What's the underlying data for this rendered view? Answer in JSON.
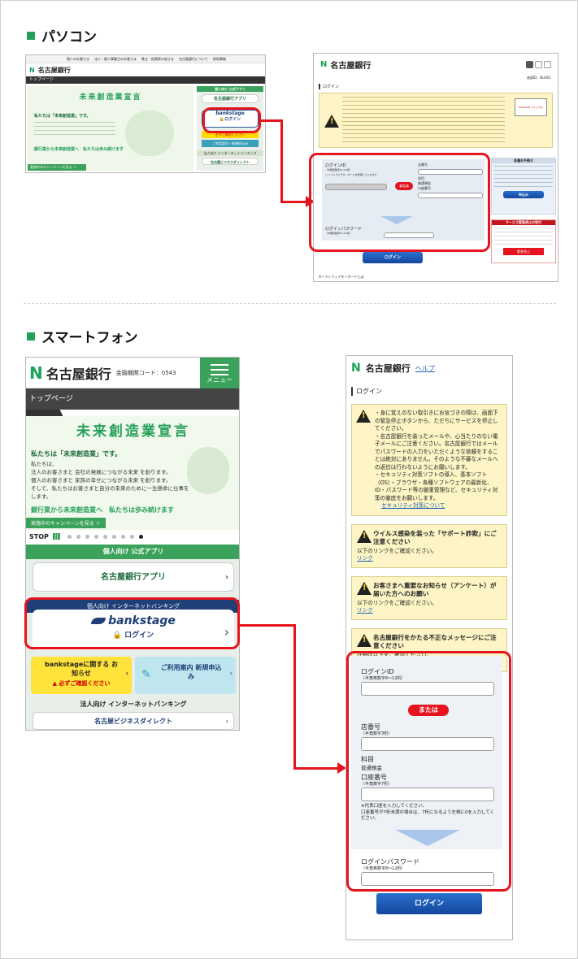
{
  "sections": {
    "pc_title": "パソコン",
    "sp_title": "スマートフォン"
  },
  "brand": {
    "bank_name": "名古屋銀行",
    "branch_code": "金融機関コード：0543",
    "menu": "メニュー",
    "accent": "#3aa25a",
    "red": "#e5141e"
  },
  "pc_top": {
    "nav_items": [
      "個人のお客さま",
      "法人・個人事業主のお客さま",
      "株主・投資家の皆さま",
      "名古屋銀行について",
      "採用情報"
    ],
    "breadcrumb": "トップページ",
    "hero_title": "未来創造業宣言",
    "hero_lead": "私たちは「未来創造業」です。",
    "hero_slogan": "銀行業から未来創造業へ　私たちは歩み続けます",
    "campaign": "実施中のキャンペーンを見る ＞",
    "app_head": "個人向け 公式アプリ",
    "app_btn": "名古屋銀行アプリ",
    "bankstage": "bankstage",
    "login": "ログイン",
    "notice": "必ずご確認ください",
    "guide": "ご利用案内・新規申込み",
    "corp_head": "法人向け インターネットバンキング",
    "corp_btn": "名古屋ビジネスダイレクト"
  },
  "pc_login": {
    "page_label": "ログイン",
    "screen_id": "画面ID：BLI001",
    "or_label": "または",
    "login_id": "ログインID",
    "login_id_hint": "（半角英数字6〜12桁）",
    "software_kb": "ソフトウェアキーボードを使用して入力する",
    "store_no": "店番号",
    "store_hint": "（半角数字3桁）",
    "subject": "科目",
    "subject_val": "普通預金",
    "account": "口座番号",
    "account_hint": "（半角数字7桁）",
    "password": "ログインパスワード",
    "password_hint": "（半角英数字8〜12桁）",
    "login_btn": "ログイン",
    "footer": "※ソフトウェアキーボードとは",
    "side_title": "各種お手続き",
    "side_btn": "申込み",
    "stop_title": "サービス緊急停止の受付",
    "stop_btn": "緊急停止",
    "phish_badge": "PhishWall プレミアム"
  },
  "sp_top": {
    "breadcrumb": "トップページ",
    "hero_title": "未来創造業宣言",
    "hero_lead": "私たちは「未来創造業」です。",
    "hero_body": [
      "私たちは、",
      "法人のお客さまと 会社の発展につながる未来 を創ります。",
      "個人のお客さまと 家族の幸せにつながる未来 を創ります。",
      "そして、私たちはお客さまと自分の未来のために一生懸命に仕事をします。"
    ],
    "hero_slogan": "銀行業から未来創造業へ　私たちは歩み続けます",
    "campaign": "実施中のキャンペーンを見る ＋",
    "stop": "STOP",
    "slide_count": 9,
    "slide_active": 8,
    "app_head": "個人向け 公式アプリ",
    "app_btn": "名古屋銀行アプリ",
    "partial_head": "個人向け インターネットバンキング",
    "bankstage": "bankstage",
    "login": "ログイン",
    "notice_title": "bankstageに関する お知らせ",
    "notice_sub": "必ずご確認ください",
    "guide_title": "ご利用案内 新規申込み",
    "corp_head": "法人向け インターネットバンキング",
    "corp_btn": "名古屋ビジネスダイレクト"
  },
  "sp_login": {
    "help": "ヘルプ",
    "page_label": "ログイン",
    "warnings": [
      "身に覚えのない取引きにお気づきの際は、画面下の緊急停止ボタンから、ただちにサービスを停止してください。",
      "名古屋銀行を装ったメールや、心当たりのない電子メールにご注意ください。名古屋銀行ではメールでパスワードの入力をいただくような依頼をすることは絶対にありません。そのような不審なメールへの返信は行わないようにお願いします。",
      "セキュリティ対策ソフトの導入、基本ソフト（OS）・ブラウザ・各種ソフトウェアの最新化、ID・パスワード等の厳重管理など、セキュリティ対策の徹底をお願いします。"
    ],
    "security_link": "セキュリティ対策について",
    "alerts": [
      {
        "title": "ウイルス感染を装った「サポート詐欺」にご注意ください",
        "body": "以下のリンクをご確認ください。",
        "link": "リンク"
      },
      {
        "title": "お客さまへ重要なお知らせ（アンケート）が届いた方へのお願い",
        "body": "以下のリンクをご確認ください。",
        "link": "リンク"
      },
      {
        "title": "名古屋銀行をかたる不正なメッセージにご注意ください",
        "body": "詳細は以下をご確認ください。",
        "link": "リンク"
      }
    ],
    "login_id": "ログインID",
    "login_id_hint": "（半角英数字6〜12桁）",
    "or_label": "または",
    "store_no": "店番号",
    "store_hint": "（半角数字3桁）",
    "subject": "科目",
    "subject_val": "普通預金",
    "account": "口座番号",
    "account_hint": "（半角数字7桁）",
    "account_note": "※代表口座を入力してください。\n口座番号が7桁未満の場合は、7桁になるよう左側に0を入力してください。",
    "password": "ログインパスワード",
    "password_hint": "（半角英数字8〜12桁）",
    "login_btn": "ログイン"
  }
}
